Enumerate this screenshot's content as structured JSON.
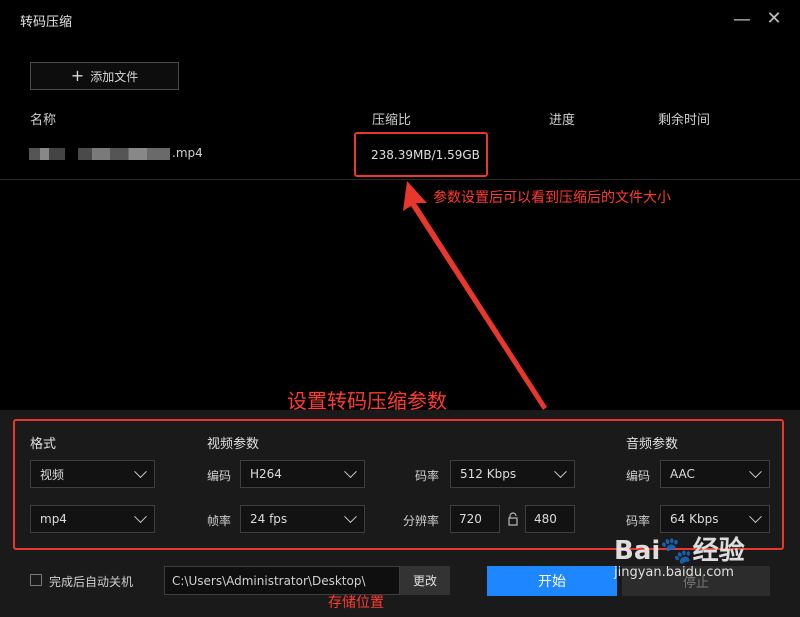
{
  "window": {
    "title": "转码压缩",
    "minimize_glyph": "—",
    "close_glyph": "✕"
  },
  "toolbar": {
    "add_file_label": "添加文件"
  },
  "table": {
    "headers": {
      "name": "名称",
      "ratio": "压缩比",
      "progress": "进度",
      "remaining": "剩余时间"
    },
    "rows": [
      {
        "name_suffix": ".mp4",
        "ratio": "238.39MB/1.59GB"
      }
    ]
  },
  "annotations": {
    "ratio_note": "参数设置后可以看到压缩后的文件大小",
    "params_note": "设置转码压缩参数",
    "storage_note": "存储位置",
    "color": "#e8372d"
  },
  "params": {
    "format": {
      "section": "格式",
      "type": "视频",
      "container": "mp4"
    },
    "video": {
      "section": "视频参数",
      "codec_label": "编码",
      "codec": "H264",
      "fps_label": "帧率",
      "fps": "24 fps",
      "bitrate_label": "码率",
      "bitrate": "512 Kbps",
      "resolution_label": "分辨率",
      "width": "720",
      "height": "480"
    },
    "audio": {
      "section": "音频参数",
      "codec_label": "编码",
      "codec": "AAC",
      "bitrate_label": "码率",
      "bitrate": "64 Kbps"
    }
  },
  "footer": {
    "auto_shutdown_label": "完成后自动关机",
    "path": "C:\\Users\\Administrator\\Desktop\\",
    "change_label": "更改",
    "start_label": "开始",
    "stop_label": "停止"
  },
  "watermark": {
    "brand": "Bai",
    "brand2": "经验",
    "url": "jingyan.baidu.com"
  },
  "colors": {
    "accent": "#1e86ff",
    "background": "#000000",
    "panel": "#1a1a1a"
  }
}
